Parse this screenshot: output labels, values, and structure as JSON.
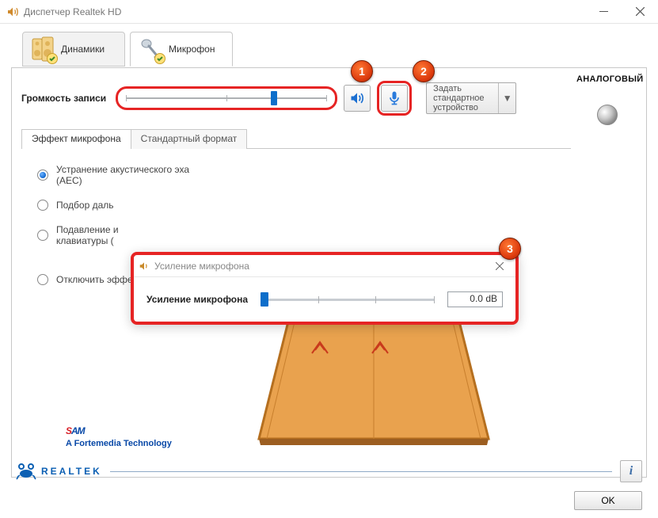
{
  "window": {
    "title": "Диспетчер Realtek HD"
  },
  "tabs": {
    "speakers": "Динамики",
    "microphone": "Микрофон"
  },
  "volume": {
    "label": "Громкость записи",
    "slider_percent": 72,
    "default_label": "Задать стандартное устройство"
  },
  "badges": {
    "one": "1",
    "two": "2",
    "three": "3"
  },
  "sidebar": {
    "title": "АНАЛОГОВЫЙ"
  },
  "subtabs": {
    "effect": "Эффект микрофона",
    "format": "Стандартный формат"
  },
  "effects": {
    "aec": "Устранение акустического эха (AEC)",
    "farfield": "Подбор даль",
    "keyboard": "Подавление и клавиатуры (",
    "off": "Отключить эффект микрофона"
  },
  "boost": {
    "title": "Усиление микрофона",
    "label": "Усиление микрофона",
    "value": "0.0 dB",
    "slider_percent": 0
  },
  "brand": {
    "sam_s": "S",
    "sam_am": "AM",
    "sam_tag": "A Fortemedia Technology",
    "realtek": "REALTEK"
  },
  "buttons": {
    "ok": "OK",
    "info": "i"
  }
}
